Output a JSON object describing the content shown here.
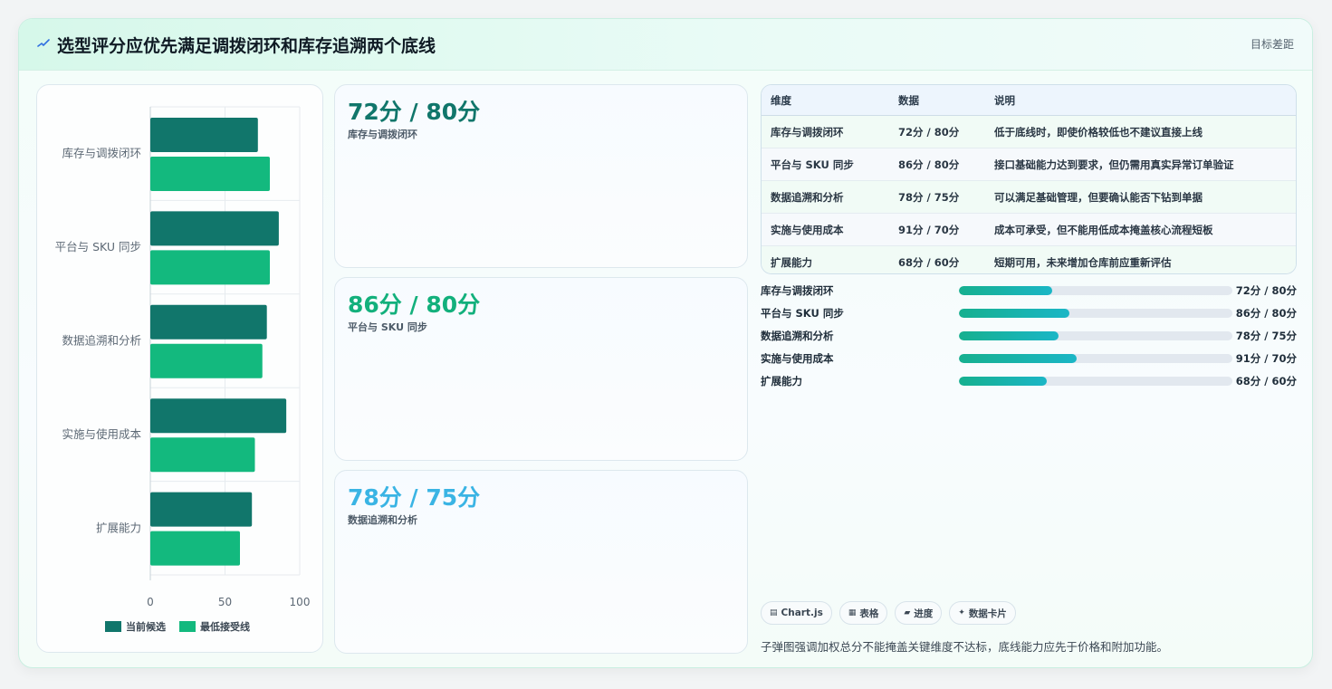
{
  "header": {
    "icon": "pulse-icon",
    "title": "选型评分应优先满足调拨闭环和库存追溯两个底线",
    "right_label": "目标差距"
  },
  "chart_data": {
    "type": "bar",
    "orientation": "horizontal",
    "categories": [
      "库存与调拨闭环",
      "平台与 SKU 同步",
      "数据追溯和分析",
      "实施与使用成本",
      "扩展能力"
    ],
    "series": [
      {
        "name": "当前候选",
        "values": [
          72,
          86,
          78,
          91,
          68
        ],
        "color": "#11766b"
      },
      {
        "name": "最低接受线",
        "values": [
          80,
          80,
          75,
          70,
          60
        ],
        "color": "#13b97e"
      }
    ],
    "xlim": [
      0,
      100
    ],
    "xticks": [
      "0",
      "50",
      "100"
    ],
    "legend_position": "bottom",
    "grid": true
  },
  "stats": [
    {
      "value": "72分 / 80分",
      "label": "库存与调拨闭环",
      "color": "#11766b"
    },
    {
      "value": "86分 / 80分",
      "label": "平台与 SKU 同步",
      "color": "#13b07c"
    },
    {
      "value": "78分 / 75分",
      "label": "数据追溯和分析",
      "color": "#3ab4e4"
    }
  ],
  "table": {
    "headers": [
      "维度",
      "数据",
      "说明"
    ],
    "rows": [
      [
        "库存与调拨闭环",
        "72分 / 80分",
        "低于底线时，即使价格较低也不建议直接上线"
      ],
      [
        "平台与 SKU 同步",
        "86分 / 80分",
        "接口基础能力达到要求，但仍需用真实异常订单验证"
      ],
      [
        "数据追溯和分析",
        "78分 / 75分",
        "可以满足基础管理，但要确认能否下钻到单据"
      ],
      [
        "实施与使用成本",
        "91分 / 70分",
        "成本可承受，但不能用低成本掩盖核心流程短板"
      ],
      [
        "扩展能力",
        "68分 / 60分",
        "短期可用，未来增加仓库前应重新评估"
      ]
    ]
  },
  "progress": [
    {
      "label": "库存与调拨闭环",
      "value": "72分 / 80分",
      "fraction": 0.34
    },
    {
      "label": "平台与 SKU 同步",
      "value": "86分 / 80分",
      "fraction": 0.405
    },
    {
      "label": "数据追溯和分析",
      "value": "78分 / 75分",
      "fraction": 0.365
    },
    {
      "label": "实施与使用成本",
      "value": "91分 / 70分",
      "fraction": 0.43
    },
    {
      "label": "扩展能力",
      "value": "68分 / 60分",
      "fraction": 0.32
    }
  ],
  "tags": [
    {
      "icon": "chart-icon",
      "glyph": "▤",
      "label": "Chart.js"
    },
    {
      "icon": "table-icon",
      "glyph": "▦",
      "label": "表格"
    },
    {
      "icon": "progress-icon",
      "glyph": "▰",
      "label": "进度"
    },
    {
      "icon": "card-icon",
      "glyph": "✦",
      "label": "数据卡片"
    }
  ],
  "footnote": "子弹图强调加权总分不能掩盖关键维度不达标，底线能力应先于价格和附加功能。"
}
